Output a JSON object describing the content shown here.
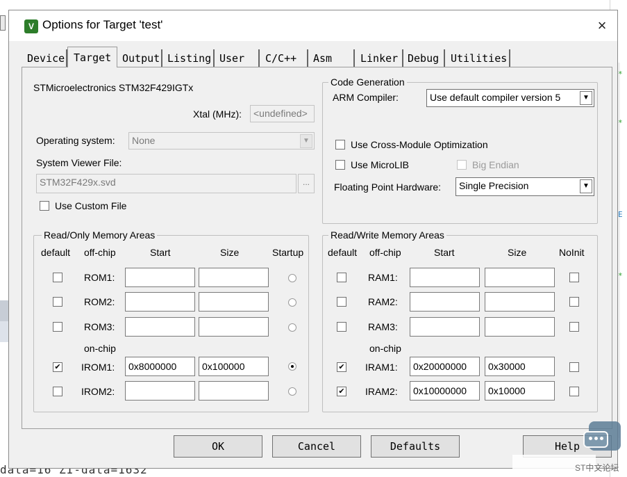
{
  "dialog": {
    "title": "Options for Target 'test'",
    "close_glyph": "×",
    "app_icon_glyph": "V"
  },
  "tabs": [
    "Device",
    "Target",
    "Output",
    "Listing",
    "User",
    "C/C++",
    "Asm",
    "Linker",
    "Debug",
    "Utilities"
  ],
  "active_tab": "Target",
  "device": {
    "name": "STMicroelectronics STM32F429IGTx",
    "xtal_label": "Xtal (MHz):",
    "xtal_value": "<undefined>"
  },
  "os": {
    "label": "Operating system:",
    "value": "None"
  },
  "svd": {
    "label": "System Viewer File:",
    "value": "STM32F429x.svd",
    "browse_label": "...",
    "custom_file_label": "Use Custom File",
    "custom_file_checked": false
  },
  "code_generation": {
    "group_title": "Code Generation",
    "compiler_label": "ARM Compiler:",
    "compiler_value": "Use default compiler version 5",
    "cross_module_label": "Use Cross-Module Optimization",
    "cross_module_checked": false,
    "microlib_label": "Use MicroLIB",
    "microlib_checked": false,
    "big_endian_label": "Big Endian",
    "big_endian_checked": false,
    "fp_label": "Floating Point Hardware:",
    "fp_value": "Single Precision"
  },
  "rom": {
    "group_title": "Read/Only Memory Areas",
    "headers": {
      "default": "default",
      "offchip": "off-chip",
      "start": "Start",
      "size": "Size",
      "startup": "Startup"
    },
    "onchip_label": "on-chip",
    "rows": [
      {
        "name": "ROM1:",
        "default": false,
        "start": "",
        "size": "",
        "startup": false
      },
      {
        "name": "ROM2:",
        "default": false,
        "start": "",
        "size": "",
        "startup": false
      },
      {
        "name": "ROM3:",
        "default": false,
        "start": "",
        "size": "",
        "startup": false
      },
      {
        "name": "IROM1:",
        "default": true,
        "start": "0x8000000",
        "size": "0x100000",
        "startup": true
      },
      {
        "name": "IROM2:",
        "default": false,
        "start": "",
        "size": "",
        "startup": false
      }
    ]
  },
  "ram": {
    "group_title": "Read/Write Memory Areas",
    "headers": {
      "default": "default",
      "offchip": "off-chip",
      "start": "Start",
      "size": "Size",
      "noinit": "NoInit"
    },
    "onchip_label": "on-chip",
    "rows": [
      {
        "name": "RAM1:",
        "default": false,
        "start": "",
        "size": "",
        "noinit": false
      },
      {
        "name": "RAM2:",
        "default": false,
        "start": "",
        "size": "",
        "noinit": false
      },
      {
        "name": "RAM3:",
        "default": false,
        "start": "",
        "size": "",
        "noinit": false
      },
      {
        "name": "IRAM1:",
        "default": true,
        "start": "0x20000000",
        "size": "0x30000",
        "noinit": false
      },
      {
        "name": "IRAM2:",
        "default": true,
        "start": "0x10000000",
        "size": "0x10000",
        "noinit": false
      }
    ]
  },
  "buttons": {
    "ok": "OK",
    "cancel": "Cancel",
    "defaults": "Defaults",
    "help": "Help"
  },
  "background": {
    "code_line": "data=16 ZI-data=1632",
    "watermark_text": "ST中文论坛",
    "right_marks": [
      "*",
      "*",
      "E",
      "*"
    ]
  },
  "check_glyph": "✔",
  "dropdown_glyph": "▼"
}
